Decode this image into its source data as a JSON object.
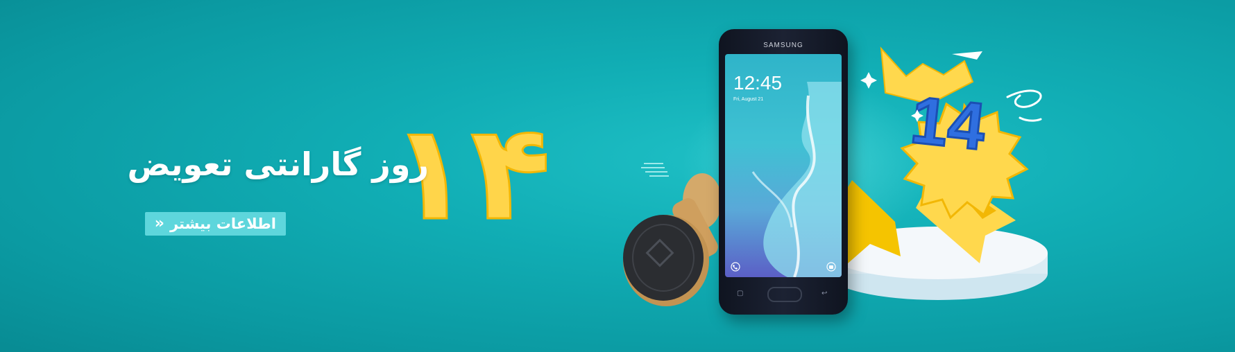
{
  "promo": {
    "number": "۱۴",
    "headline": "روز گارانتی تعویض",
    "cta_label": "اطلاعات بیشتر",
    "cta_chevron": "«"
  },
  "phone": {
    "brand": "SAMSUNG",
    "time": "12:45",
    "date": "Fri, August 21"
  },
  "badge": {
    "number": "14"
  },
  "colors": {
    "background": "#11aeb5",
    "number_yellow": "#ffd54a",
    "badge_yellow": "#ffd84d",
    "badge_blue": "#2f6fe0",
    "cta_bg": "#5ed6dc",
    "text": "#ffffff"
  },
  "icons": [
    "chevron-left-double-icon",
    "phone-icon",
    "camera-icon",
    "back-icon",
    "recent-apps-icon",
    "sparkle-icon"
  ]
}
